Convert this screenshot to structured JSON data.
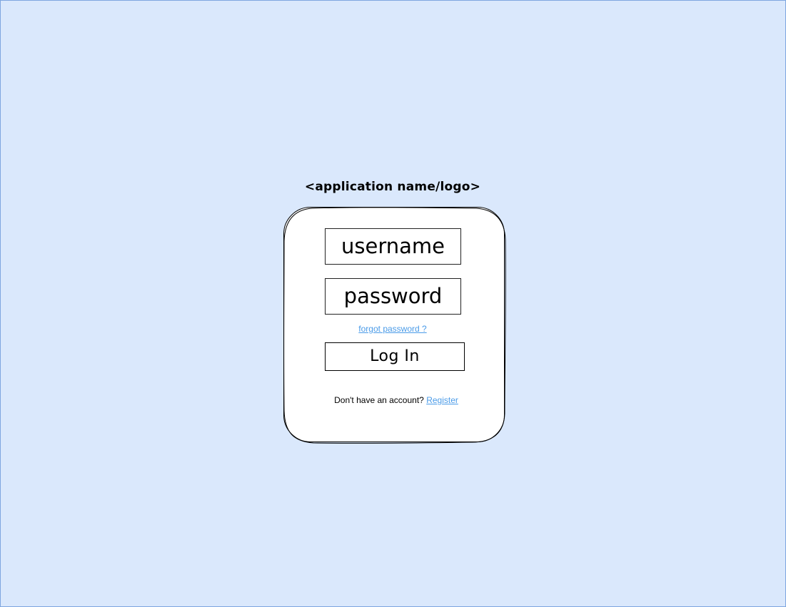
{
  "app": {
    "title": "<application name/logo>"
  },
  "login_form": {
    "username_placeholder": "username",
    "password_placeholder": "password",
    "forgot_password_label": "forgot password ?",
    "login_button_label": "Log In",
    "register_prompt": "Don't have an account?",
    "register_link_label": "Register"
  },
  "colors": {
    "background": "#dae8fc",
    "background_border": "#7ea6e0",
    "card": "#ffffff",
    "link": "#4a9be8"
  }
}
